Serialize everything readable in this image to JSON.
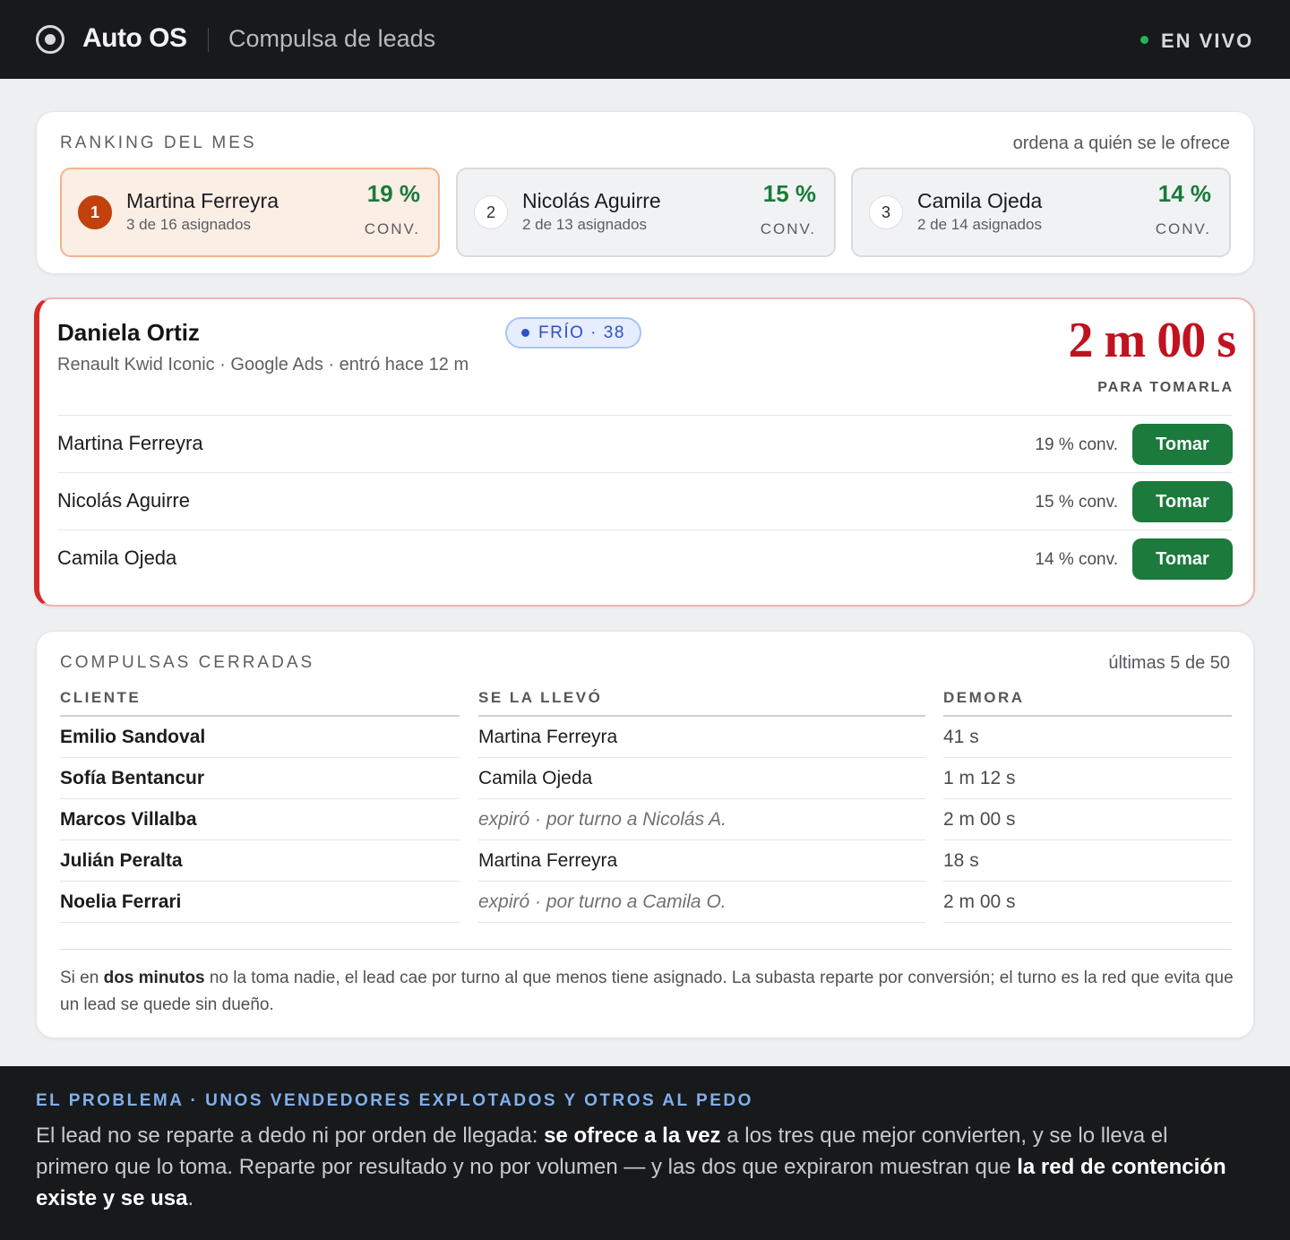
{
  "header": {
    "app_name": "Auto OS",
    "subtitle": "Compulsa de leads",
    "live_label": "EN VIVO",
    "live_color": "#22b45a"
  },
  "ranking": {
    "title": "RANKING DEL MES",
    "hint": "ordena a quién se le ofrece",
    "items": [
      {
        "position": "1",
        "name": "Martina Ferreyra",
        "assigned": "3 de 16 asignados",
        "pct": "19 %",
        "unit": "CONV."
      },
      {
        "position": "2",
        "name": "Nicolás Aguirre",
        "assigned": "2 de 13 asignados",
        "pct": "15 %",
        "unit": "CONV."
      },
      {
        "position": "3",
        "name": "Camila Ojeda",
        "assigned": "2 de 14 asignados",
        "pct": "14 %",
        "unit": "CONV."
      }
    ]
  },
  "lead": {
    "name": "Daniela Ortiz",
    "tag": "FRÍO · 38",
    "meta": "Renault Kwid Iconic · Google Ads · entró hace 12 m",
    "timer": "2 m 00 s",
    "timer_label": "PARA TOMARLA",
    "accent_color": "#d42a2a",
    "offers": [
      {
        "name": "Martina Ferreyra",
        "pct": "19 % conv.",
        "action": "Tomar"
      },
      {
        "name": "Nicolás Aguirre",
        "pct": "15 % conv.",
        "action": "Tomar"
      },
      {
        "name": "Camila Ojeda",
        "pct": "14 % conv.",
        "action": "Tomar"
      }
    ]
  },
  "closed": {
    "title": "COMPULSAS CERRADAS",
    "hint": "últimas 5 de 50",
    "columns": [
      "CLIENTE",
      "SE LA LLEVÓ",
      "DEMORA"
    ],
    "rows": [
      {
        "client": "Emilio Sandoval",
        "taker": "Martina Ferreyra",
        "expired": false,
        "delay": "41 s"
      },
      {
        "client": "Sofía Bentancur",
        "taker": "Camila Ojeda",
        "expired": false,
        "delay": "1 m 12 s"
      },
      {
        "client": "Marcos Villalba",
        "taker": "expiró · por turno a Nicolás A.",
        "expired": true,
        "delay": "2 m 00 s"
      },
      {
        "client": "Julián Peralta",
        "taker": "Martina Ferreyra",
        "expired": false,
        "delay": "18 s"
      },
      {
        "client": "Noelia Ferrari",
        "taker": "expiró · por turno a Camila O.",
        "expired": true,
        "delay": "2 m 00 s"
      }
    ],
    "footnote": {
      "before": "Si en ",
      "bold": "dos minutos",
      "after": " no la toma nadie, el lead cae por turno al que menos tiene asignado. La subasta reparte por conversión; el turno es la red que evita que un lead se quede sin dueño."
    }
  },
  "problem": {
    "kicker": "EL PROBLEMA · UNOS VENDEDORES EXPLOTADOS Y OTROS AL PEDO",
    "text_1": "El lead no se reparte a dedo ni por orden de llegada: ",
    "bold_1": "se ofrece a la vez",
    "text_2": " a los tres que mejor convierten, y se lo lleva el primero que lo toma. Reparte por resultado y no por volumen — y las dos que expiraron muestran que ",
    "bold_2": "la red de contención existe y se usa",
    "text_3": "."
  }
}
